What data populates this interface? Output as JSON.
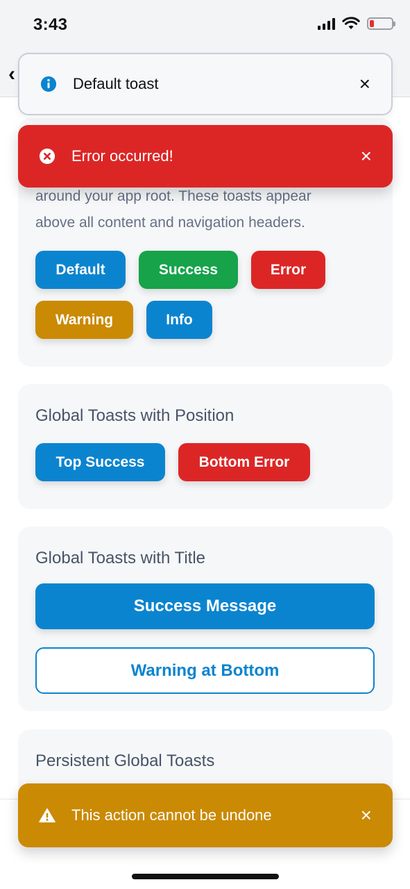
{
  "status_bar": {
    "time": "3:43"
  },
  "header": {
    "back_icon": "chevron-left-icon"
  },
  "section_intro": {
    "line1": "around your app root. These toasts appear",
    "line2": "above all content and navigation headers.",
    "buttons": {
      "default": "Default",
      "success": "Success",
      "error": "Error",
      "warning": "Warning",
      "info": "Info"
    }
  },
  "section_position": {
    "title": "Global Toasts with Position",
    "buttons": {
      "top_success": "Top Success",
      "bottom_error": "Bottom Error"
    }
  },
  "section_title": {
    "title": "Global Toasts with Title",
    "buttons": {
      "success_message": "Success Message",
      "warning_bottom": "Warning at Bottom"
    }
  },
  "section_persistent": {
    "title": "Persistent Global Toasts"
  },
  "toasts": {
    "default": {
      "text": "Default toast",
      "icon": "info-icon",
      "close": "×"
    },
    "error": {
      "text": "Error occurred!",
      "icon": "error-circle-icon",
      "close": "×"
    },
    "warning": {
      "text": "This action cannot be undone",
      "icon": "warning-triangle-icon",
      "close": "×"
    }
  },
  "colors": {
    "primary": "#0b84cf",
    "success": "#16a34a",
    "error": "#dc2626",
    "warning": "#ca8a04"
  }
}
